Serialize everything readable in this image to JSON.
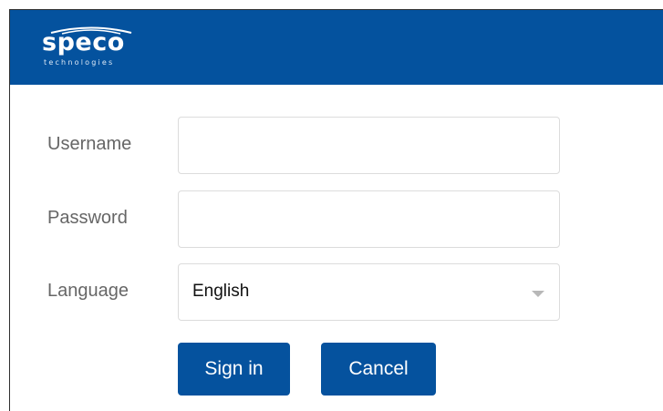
{
  "brand": {
    "name": "speco",
    "tagline": "technologies",
    "color": "#04529e"
  },
  "form": {
    "username": {
      "label": "Username",
      "value": "",
      "placeholder": ""
    },
    "password": {
      "label": "Password",
      "value": "",
      "placeholder": ""
    },
    "language": {
      "label": "Language",
      "selected": "English",
      "icon": "chevron-down-icon"
    }
  },
  "buttons": {
    "sign_in": "Sign in",
    "cancel": "Cancel"
  }
}
